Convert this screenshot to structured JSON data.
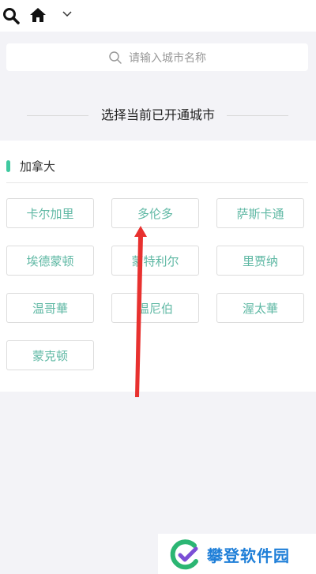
{
  "topbar": {
    "icons": [
      "search-icon",
      "home-icon",
      "chevron-down-icon"
    ]
  },
  "search": {
    "placeholder": "请输入城市名称"
  },
  "section_title": "选择当前已开通城市",
  "country": {
    "name": "加拿大",
    "accent_color": "#3fc9a0",
    "cities": [
      "卡尔加里",
      "多伦多",
      "萨斯卡通",
      "埃德蒙顿",
      "蒙特利尔",
      "里贾纳",
      "温哥華",
      "温尼伯",
      "渥太華",
      "蒙克顿"
    ]
  },
  "city_text_color": "#5fb8a4",
  "annotation": {
    "arrow_color": "#e8312f"
  },
  "watermark": {
    "text": "攀登软件园",
    "color": "#1f7fd8"
  }
}
